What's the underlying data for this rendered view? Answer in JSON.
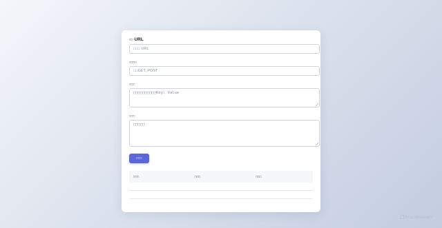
{
  "form": {
    "url_label_prefix": "□□",
    "url_label": "URL",
    "url_placeholder": "□□□ URL",
    "method_label": "□□□□",
    "method_placeholder": "□□GET, POST",
    "headers_label": "□□□",
    "headers_placeholder": "□□□□□□□□□□Key: Value",
    "body_label": "□□□",
    "body_placeholder": "□□□□□",
    "submit_label": "□□□"
  },
  "results": {
    "columns": [
      "□□□",
      "□□□",
      "□□□"
    ]
  },
  "watermark": {
    "text": "ScanMalware"
  },
  "colors": {
    "accent": "#5a67d8",
    "card": "#ffffff",
    "watermark": "#b7c3d9"
  }
}
